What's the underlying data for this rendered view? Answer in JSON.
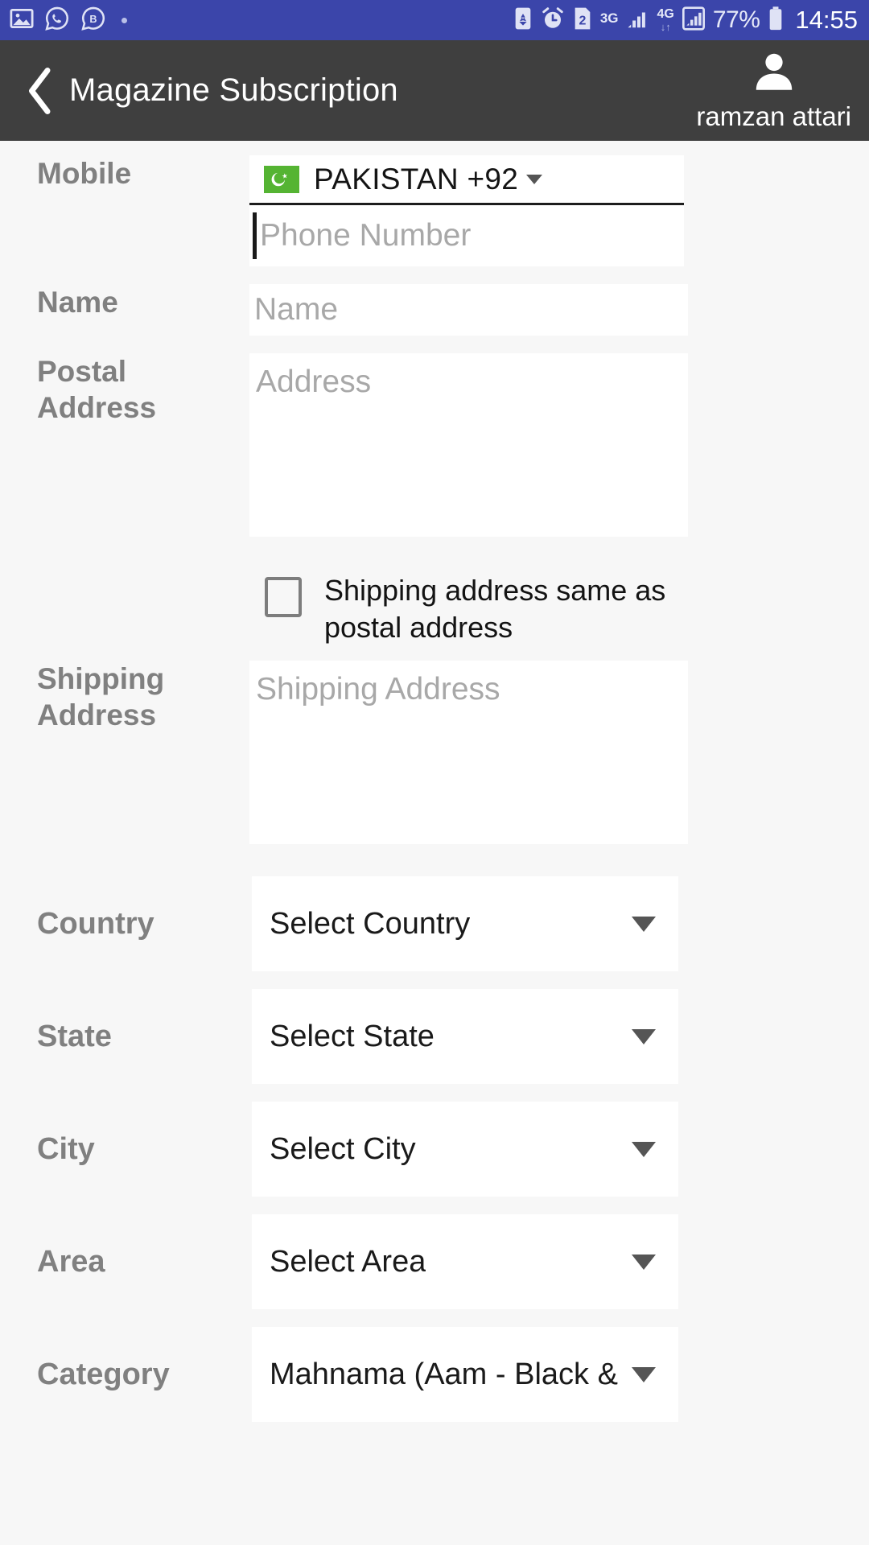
{
  "status_bar": {
    "background_color": "#3b45aa",
    "left_icons": [
      {
        "name": "gallery-icon",
        "label": "image"
      },
      {
        "name": "whatsapp-icon",
        "label": "whatsapp"
      },
      {
        "name": "bip-message-icon",
        "label": "B"
      }
    ],
    "right": {
      "battery_saver_label": "recycle",
      "alarm_label": "alarm",
      "sim_label": "2",
      "network_3g": "3G",
      "network_4g": "4G",
      "battery_percent": "77%",
      "time": "14:55"
    }
  },
  "app_bar": {
    "background_color": "#3f3f3f",
    "back_label": "❮",
    "title": "Magazine Subscription",
    "profile_name": "ramzan attari"
  },
  "form": {
    "mobile": {
      "label": "Mobile",
      "country_code_value": "PAKISTAN +92",
      "flag_country": "Pakistan",
      "flag_color": "#55b433",
      "phone_placeholder": "Phone Number",
      "phone_value": ""
    },
    "name": {
      "label": "Name",
      "placeholder": "Name",
      "value": ""
    },
    "postal_address": {
      "label": "Postal Address",
      "placeholder": "Address",
      "value": ""
    },
    "shipping_same_checkbox": {
      "label": "Shipping address same as postal address",
      "checked": false
    },
    "shipping_address": {
      "label": "Shipping Address",
      "placeholder": "Shipping Address",
      "value": ""
    },
    "country": {
      "label": "Country",
      "value": "Select Country"
    },
    "state": {
      "label": "State",
      "value": "Select State"
    },
    "city": {
      "label": "City",
      "value": "Select City"
    },
    "area": {
      "label": "Area",
      "value": "Select Area"
    },
    "category": {
      "label": "Category",
      "value": "Mahnama (Aam - Black &"
    }
  }
}
